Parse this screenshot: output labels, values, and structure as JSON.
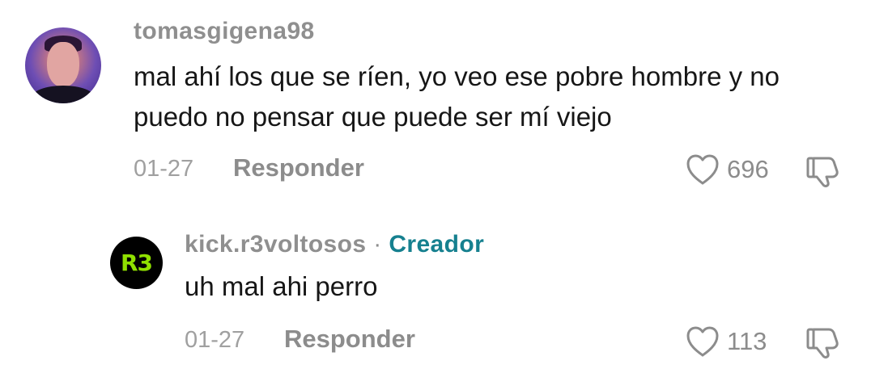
{
  "comments": [
    {
      "username": "tomasgigena98",
      "text": "mal ahí los que se ríen, yo veo ese pobre hombre y no\npuedo no pensar que puede ser mí viejo",
      "date": "01-27",
      "reply_label": "Responder",
      "likes": "696"
    },
    {
      "username": "kick.r3voltosos",
      "separator": "·",
      "badge": "Creador",
      "text": "uh mal ahi perro",
      "date": "01-27",
      "reply_label": "Responder",
      "likes": "113",
      "avatar_text": "R3"
    }
  ],
  "colors": {
    "username": "#8f8f8f",
    "body": "#161616",
    "meta": "#8c8c8c",
    "creator": "#16808f",
    "r3_logo": "#8fe000"
  },
  "icons": {
    "like": "heart-outline-icon",
    "dislike": "thumbs-down-icon"
  }
}
